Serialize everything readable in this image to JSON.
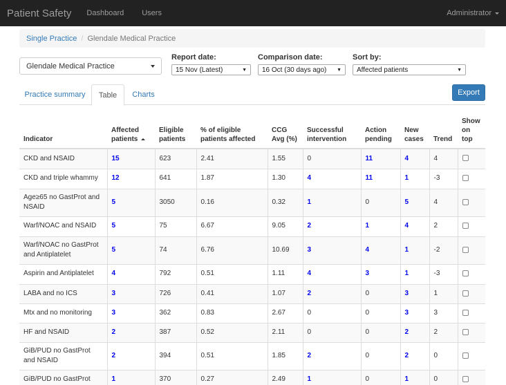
{
  "navbar": {
    "brand": "Patient Safety",
    "links": [
      "Dashboard",
      "Users"
    ],
    "user": "Administrator"
  },
  "breadcrumb": {
    "items": [
      "Single Practice",
      "Glendale Medical Practice"
    ]
  },
  "controls": {
    "practice": "Glendale Medical Practice",
    "report_date_label": "Report date:",
    "report_date_value": "15 Nov (Latest)",
    "comparison_date_label": "Comparison date:",
    "comparison_date_value": "16 Oct (30 days ago)",
    "sort_by_label": "Sort by:",
    "sort_by_value": "Affected patients"
  },
  "tabs": [
    "Practice summary",
    "Table",
    "Charts"
  ],
  "export_label": "Export",
  "table": {
    "headers": [
      "Indicator",
      "Affected patients",
      "Eligible patients",
      "% of eligible patients affected",
      "CCG Avg (%)",
      "Successful intervention",
      "Action pending",
      "New cases",
      "Trend",
      "Show on top"
    ],
    "rows": [
      [
        "CKD and NSAID",
        "15",
        "623",
        "2.41",
        "1.55",
        "0",
        "11",
        "4",
        "4"
      ],
      [
        "CKD and triple whammy",
        "12",
        "641",
        "1.87",
        "1.30",
        "4",
        "11",
        "1",
        "-3"
      ],
      [
        "Age≥65 no GastProt and NSAID",
        "5",
        "3050",
        "0.16",
        "0.32",
        "1",
        "0",
        "5",
        "4"
      ],
      [
        "Warf/NOAC and NSAID",
        "5",
        "75",
        "6.67",
        "9.05",
        "2",
        "1",
        "4",
        "2"
      ],
      [
        "Warf/NOAC no GastProt and Antiplatelet",
        "5",
        "74",
        "6.76",
        "10.69",
        "3",
        "4",
        "1",
        "-2"
      ],
      [
        "Aspirin and Antiplatelet",
        "4",
        "792",
        "0.51",
        "1.11",
        "4",
        "3",
        "1",
        "-3"
      ],
      [
        "LABA and no ICS",
        "3",
        "726",
        "0.41",
        "1.07",
        "2",
        "0",
        "3",
        "1"
      ],
      [
        "Mtx and no monitoring",
        "3",
        "362",
        "0.83",
        "2.67",
        "0",
        "0",
        "3",
        "3"
      ],
      [
        "HF and NSAID",
        "2",
        "387",
        "0.52",
        "2.11",
        "0",
        "0",
        "2",
        "2"
      ],
      [
        "GiB/PUD no GastProt and NSAID",
        "2",
        "394",
        "0.51",
        "1.85",
        "2",
        "0",
        "2",
        "0"
      ],
      [
        "GiB/PUD no GastProt",
        "1",
        "370",
        "0.27",
        "2.49",
        "1",
        "0",
        "1",
        "0"
      ]
    ]
  }
}
